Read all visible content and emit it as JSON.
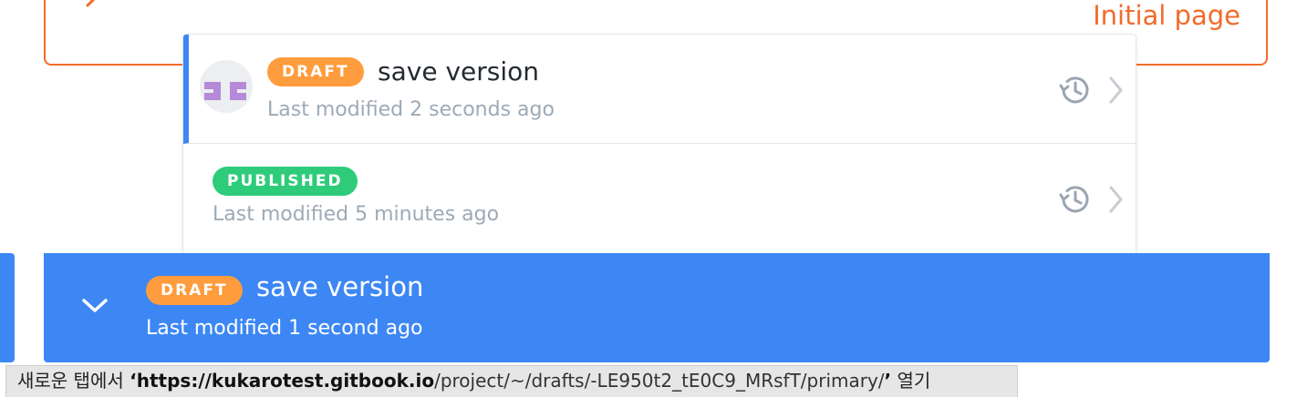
{
  "background_card": {
    "title": "Initial page",
    "accent_color": "#f26b2a",
    "icon": "chevron-left-icon"
  },
  "versions": [
    {
      "status": "DRAFT",
      "status_color": "#ff9c3d",
      "title": "save version",
      "modified": "Last modified 2 seconds ago",
      "has_avatar": true
    },
    {
      "status": "PUBLISHED",
      "status_color": "#2ecc7a",
      "title": "",
      "modified": "Last modified 5 minutes ago",
      "has_avatar": false
    }
  ],
  "current_version": {
    "status": "DRAFT",
    "title": "save version",
    "modified": "Last modified 1 second ago",
    "background_color": "#3d87f5",
    "icon": "chevron-down-icon"
  },
  "status_bar": {
    "prefix": "새로운 탭에서 ",
    "quote_open": "‘",
    "scheme_host": "https://kukarotest.gitbook.io",
    "path": "/project/~/drafts/-LE950t2_tE0C9_MRsfT/primary/",
    "quote_close": "’",
    "suffix": " 열기"
  }
}
